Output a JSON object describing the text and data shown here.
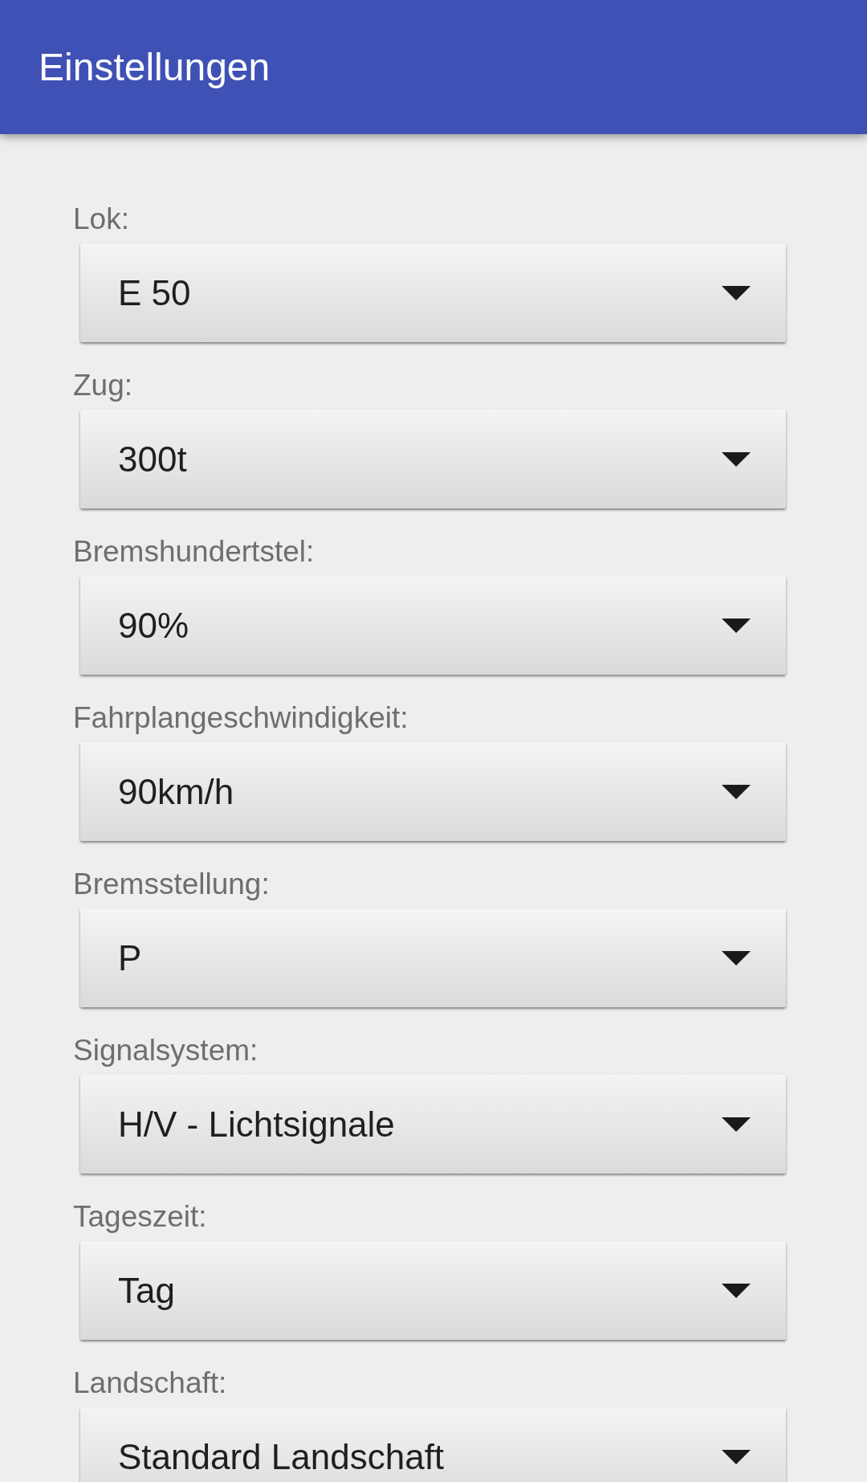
{
  "app_bar": {
    "title": "Einstellungen"
  },
  "settings": [
    {
      "label": "Lok:",
      "value": "E 50"
    },
    {
      "label": "Zug:",
      "value": "300t"
    },
    {
      "label": "Bremshundertstel:",
      "value": "90%"
    },
    {
      "label": "Fahrplangeschwindigkeit:",
      "value": "90km/h"
    },
    {
      "label": "Bremsstellung:",
      "value": "P"
    },
    {
      "label": "Signalsystem:",
      "value": "H/V - Lichtsignale"
    },
    {
      "label": "Tageszeit:",
      "value": "Tag"
    },
    {
      "label": "Landschaft:",
      "value": "Standard Landschaft"
    }
  ]
}
